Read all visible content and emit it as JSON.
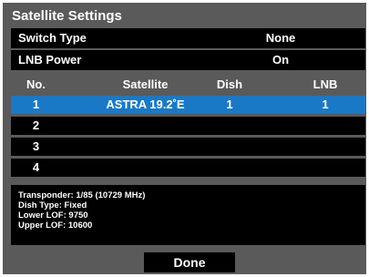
{
  "title": "Satellite Settings",
  "settings": [
    {
      "label": "Switch Type",
      "value": "None"
    },
    {
      "label": "LNB Power",
      "value": "On"
    }
  ],
  "table": {
    "headers": [
      "No.",
      "Satellite",
      "Dish",
      "LNB"
    ],
    "rows": [
      {
        "no": "1",
        "satellite": "ASTRA 19.2˚E",
        "dish": "1",
        "lnb": "1",
        "selected": true
      },
      {
        "no": "2",
        "satellite": "",
        "dish": "",
        "lnb": ""
      },
      {
        "no": "3",
        "satellite": "",
        "dish": "",
        "lnb": ""
      },
      {
        "no": "4",
        "satellite": "",
        "dish": "",
        "lnb": ""
      }
    ]
  },
  "info": {
    "transponder": "Transponder: 1/85 (10729 MHz)",
    "dish_type": "Dish Type: Fixed",
    "lower_lof": "Lower LOF: 9750",
    "upper_lof": "Upper LOF: 10600"
  },
  "done_label": "Done",
  "colors": {
    "panel": "#5a5a5a",
    "row": "#000000",
    "selected": "#1a79c7"
  }
}
